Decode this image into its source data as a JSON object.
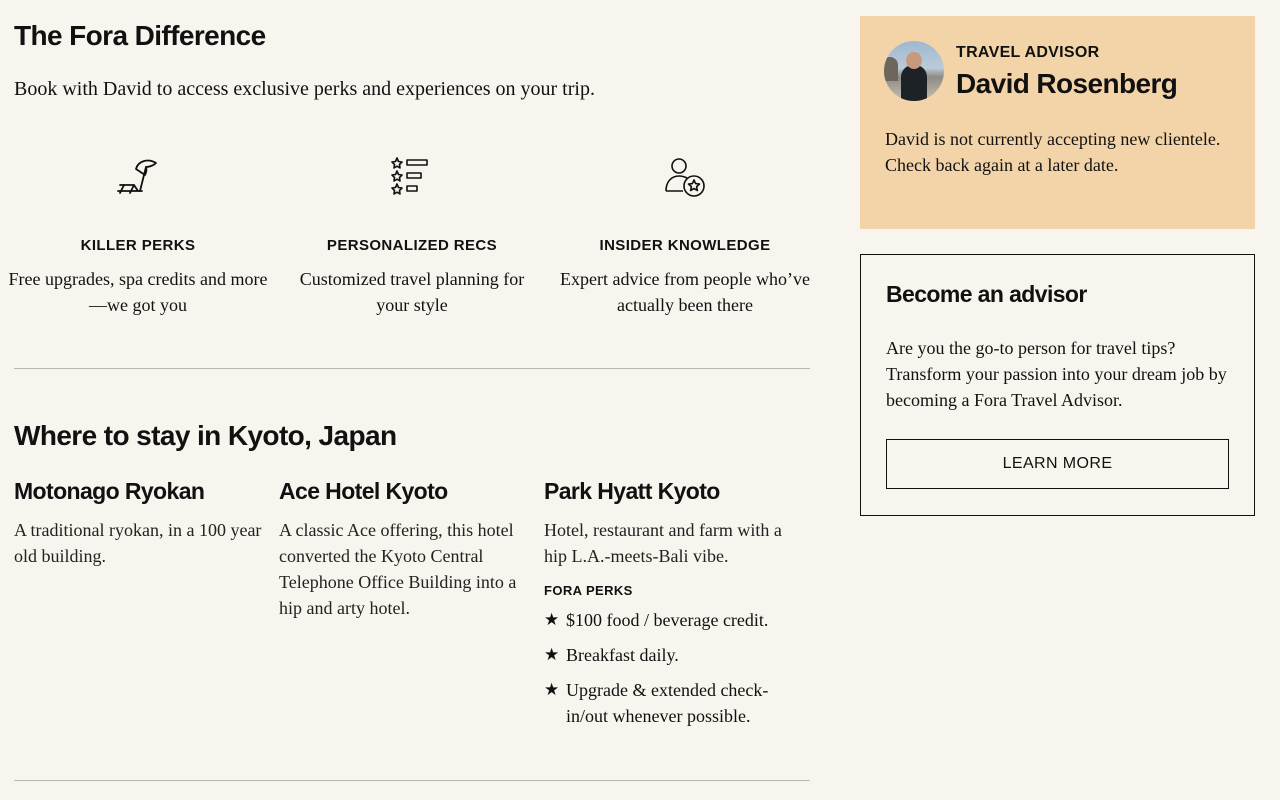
{
  "difference": {
    "title": "The Fora Difference",
    "intro": "Book with David to access exclusive perks and experiences on your trip.",
    "features": [
      {
        "icon": "beach-umbrella-icon",
        "title": "KILLER PERKS",
        "desc": "Free upgrades, spa credits and more—we got you"
      },
      {
        "icon": "star-list-icon",
        "title": "PERSONALIZED RECS",
        "desc": "Customized travel planning for your style"
      },
      {
        "icon": "person-star-icon",
        "title": "INSIDER KNOWLEDGE",
        "desc": "Expert advice from people who’ve actually been there"
      }
    ]
  },
  "stay": {
    "title": "Where to stay in Kyoto, Japan",
    "hotels": [
      {
        "name": "Motonago Ryokan",
        "desc": "A traditional ryokan, in a 100 year old building."
      },
      {
        "name": "Ace Hotel Kyoto",
        "desc": "A classic Ace offering, this hotel converted the Kyoto Central Telephone Office Building into a hip and arty hotel."
      },
      {
        "name": "Park Hyatt Kyoto",
        "desc": "Hotel, restaurant and farm with a hip L.A.-meets-Bali vibe.",
        "perks_title": "FORA PERKS",
        "perks": [
          "$100 food / beverage credit.",
          "Breakfast daily.",
          "Upgrade & extended check-in/out whenever possible."
        ]
      }
    ]
  },
  "advisor": {
    "label": "TRAVEL ADVISOR",
    "name": "David Rosenberg",
    "note": "David is not currently accepting new clientele. Check back again at a later date."
  },
  "become": {
    "title": "Become an advisor",
    "text": "Are you the go-to person for travel tips? Transform your passion into your dream job by becoming a Fora Travel Advisor.",
    "button": "LEARN MORE"
  },
  "colors": {
    "background": "#f8f4ee",
    "advisor_card": "#f3d4a8",
    "text": "#111111",
    "divider": "#b8b4ae"
  }
}
